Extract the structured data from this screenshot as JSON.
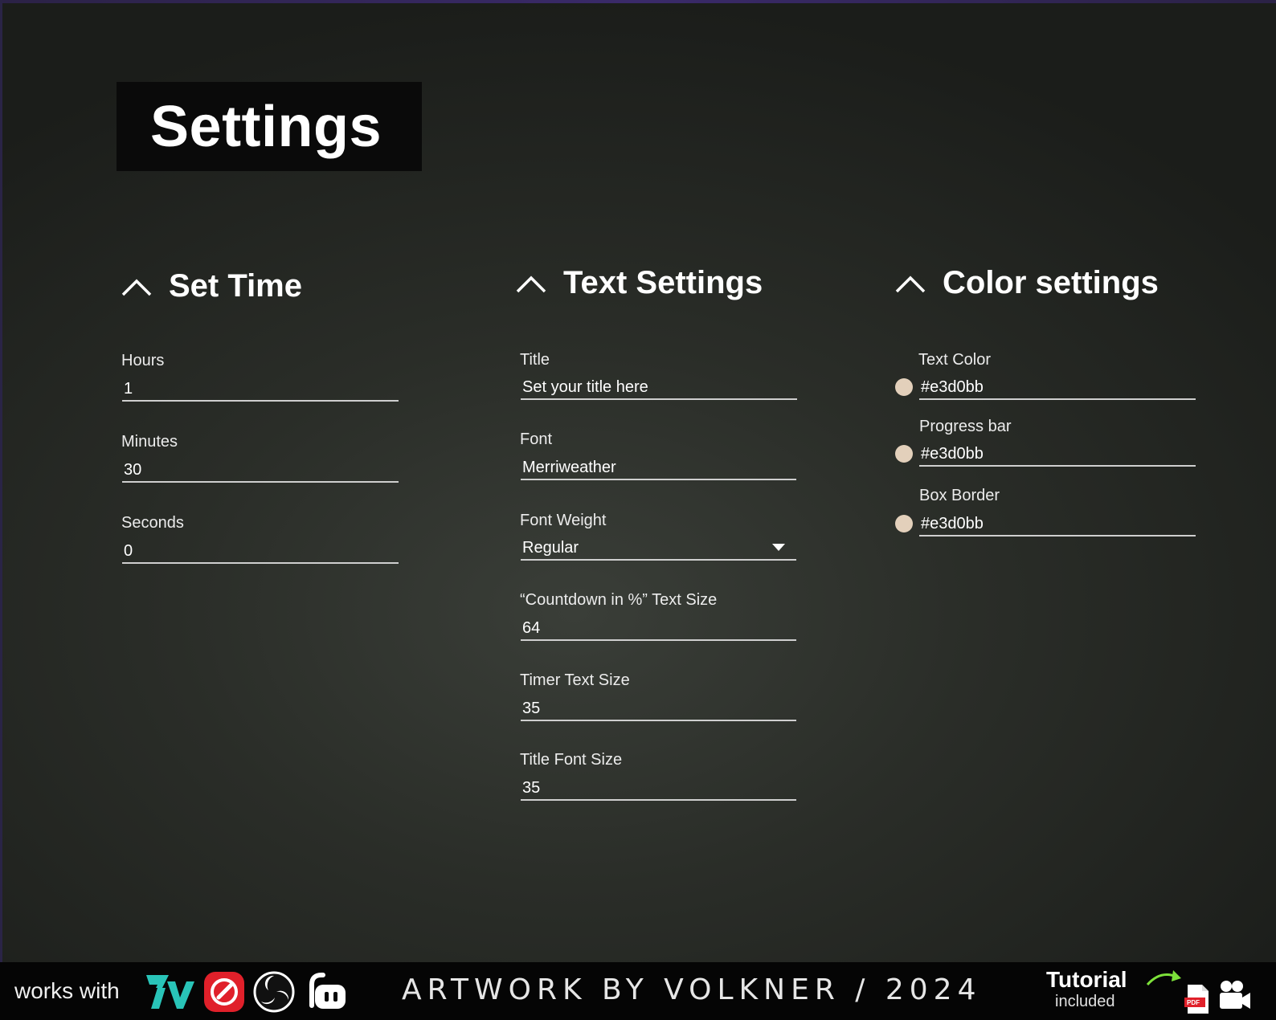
{
  "page_title": "Settings",
  "sections": {
    "set_time": {
      "title": "Set Time",
      "fields": [
        {
          "label": "Hours",
          "value": "1"
        },
        {
          "label": "Minutes",
          "value": "30"
        },
        {
          "label": "Seconds",
          "value": "0"
        }
      ]
    },
    "text_settings": {
      "title": "Text Settings",
      "fields": [
        {
          "label": "Title",
          "value": "Set your title here"
        },
        {
          "label": "Font",
          "value": "Merriweather"
        },
        {
          "label": "Font Weight",
          "value": "Regular"
        },
        {
          "label": "“Countdown in %” Text Size",
          "value": "64"
        },
        {
          "label": "Timer Text Size",
          "value": "35"
        },
        {
          "label": "Title Font Size",
          "value": "35"
        }
      ]
    },
    "color_settings": {
      "title": "Color settings",
      "fields": [
        {
          "label": "Text Color",
          "value": "#e3d0bb",
          "swatch": "#e3d0bb"
        },
        {
          "label": "Progress bar",
          "value": "#e3d0bb",
          "swatch": "#e3d0bb"
        },
        {
          "label": "Box Border",
          "value": "#e3d0bb",
          "swatch": "#e3d0bb"
        }
      ]
    }
  },
  "footer": {
    "works_with": "works with",
    "logos": [
      "7tv-logo",
      "streamelements-logo",
      "obs-logo",
      "streamlabs-logo"
    ],
    "credit": "ARTWORK BY VOLKNER / 2024",
    "tutorial": "Tutorial",
    "included": "included",
    "icons": [
      "arrow-icon",
      "pdf-icon",
      "video-camera-icon"
    ]
  },
  "colors": {
    "accent_7tv": "#29c4b8",
    "accent_red": "#e0202a",
    "arrow_green": "#7de23a"
  }
}
